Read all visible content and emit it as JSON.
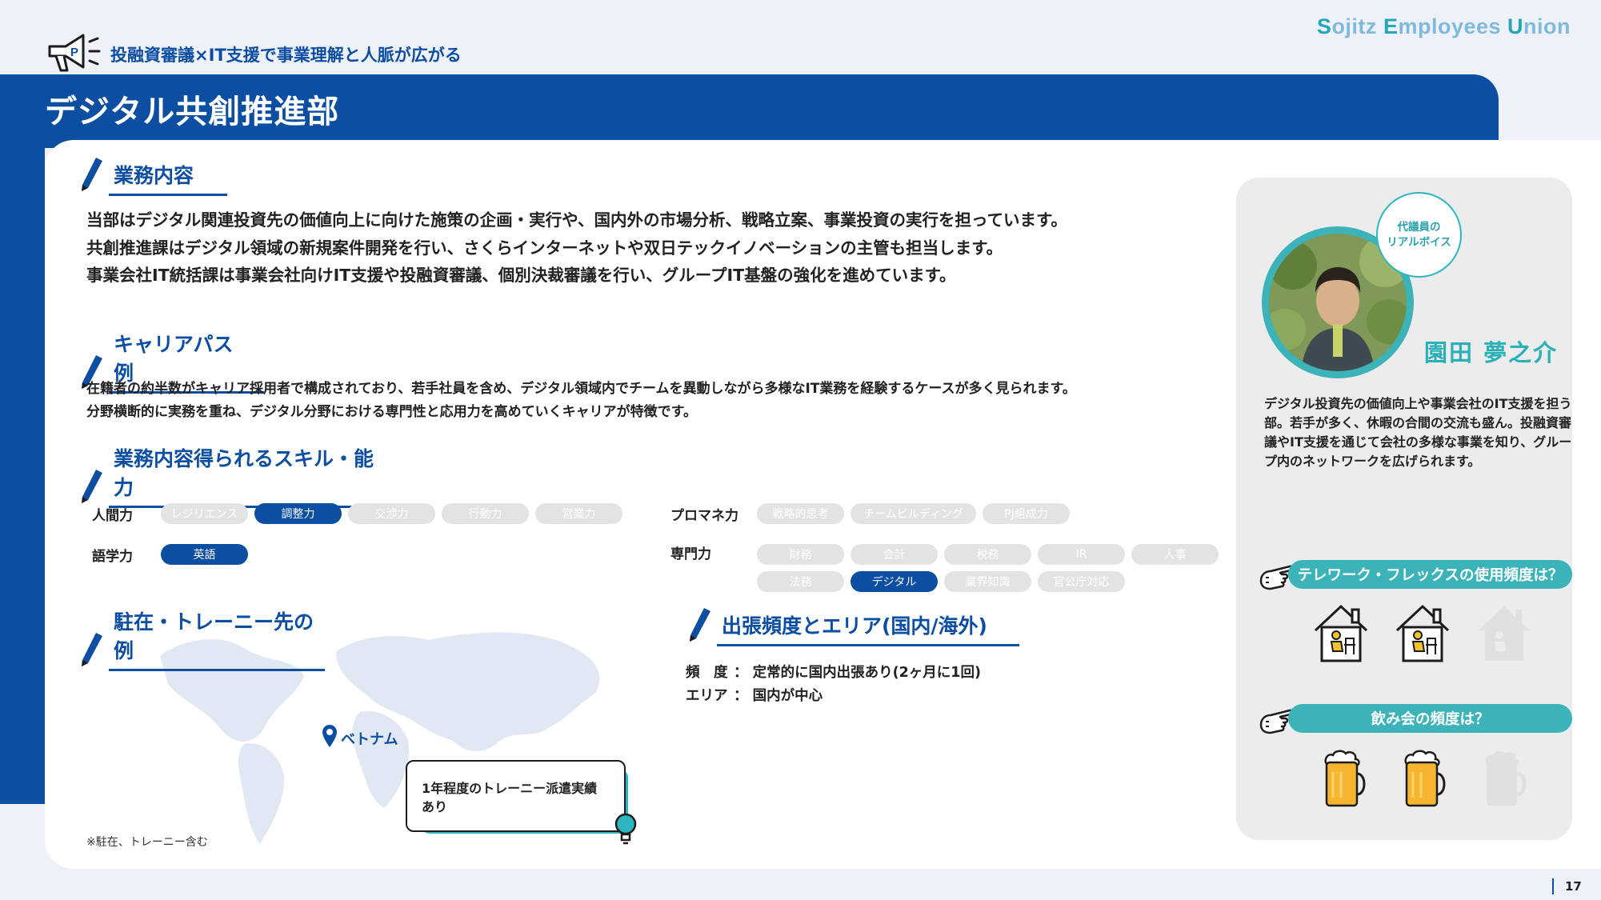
{
  "brand": {
    "parts": [
      {
        "cap": "S",
        "rest": "ojitz "
      },
      {
        "cap": "E",
        "rest": "mployees "
      },
      {
        "cap": "U",
        "rest": "nion"
      }
    ]
  },
  "header": {
    "subtitle": "投融資審議×IT支援で事業理解と人脈が広がる",
    "title": "デジタル共創推進部"
  },
  "sections": {
    "business": {
      "heading": "業務内容",
      "lines": [
        "当部はデジタル関連投資先の価値向上に向けた施策の企画・実行や、国内外の市場分析、戦略立案、事業投資の実行を担っています。",
        "共創推進課はデジタル領域の新規案件開発を行い、さくらインターネットや双日テックイノベーションの主管も担当します。",
        "事業会社IT統括課は事業会社向けIT支援や投融資審議、個別決裁審議を行い、グループIT基盤の強化を進めています。"
      ]
    },
    "career": {
      "heading": "キャリアパス例",
      "lines": [
        "在籍者の約半数がキャリア採用者で構成されており、若手社員を含め、デジタル領域内でチームを異動しながら多様なIT業務を経験するケースが多く見られます。",
        "分野横断的に実務を重ね、デジタル分野における専門性と応用力を高めていくキャリアが特徴です。"
      ]
    },
    "skills": {
      "heading": "業務内容得られるスキル・能力",
      "groups": [
        {
          "label": "人間力",
          "items": [
            {
              "name": "レジリエンス",
              "active": false
            },
            {
              "name": "調整力",
              "active": true
            },
            {
              "name": "交渉力",
              "active": false
            },
            {
              "name": "行動力",
              "active": false
            },
            {
              "name": "営業力",
              "active": false
            }
          ]
        },
        {
          "label": "語学力",
          "items": [
            {
              "name": "英語",
              "active": true
            }
          ]
        },
        {
          "label": "プロマネ力",
          "items": [
            {
              "name": "戦略的思考",
              "active": false
            },
            {
              "name": "チームビルディング",
              "active": false
            },
            {
              "name": "PJ組成力",
              "active": false
            }
          ]
        },
        {
          "label": "専門力",
          "items": [
            {
              "name": "財務",
              "active": false
            },
            {
              "name": "会計",
              "active": false
            },
            {
              "name": "税務",
              "active": false
            },
            {
              "name": "IR",
              "active": false
            },
            {
              "name": "人事",
              "active": false
            },
            {
              "name": "法務",
              "active": false
            },
            {
              "name": "デジタル",
              "active": true
            },
            {
              "name": "業界知識",
              "active": false
            },
            {
              "name": "官公庁対応",
              "active": false
            }
          ]
        }
      ]
    },
    "postings": {
      "heading": "駐在・トレーニー先の例",
      "location": "ベトナム",
      "callout_line1": "1年程度のトレーニー派遣実績",
      "callout_line2": "あり",
      "note": "※駐在、トレーニー含む"
    },
    "travel": {
      "heading": "出張頻度とエリア(国内/海外)",
      "rows": [
        {
          "key": "頻　度",
          "value": "定常的に国内出張あり(2ヶ月に1回)"
        },
        {
          "key": "エリア",
          "value": "国内が中心"
        }
      ]
    }
  },
  "voice": {
    "bubble_line1": "代議員の",
    "bubble_line2": "リアルボイス",
    "name": "園田 夢之介",
    "description": "デジタル投資先の価値向上や事業会社のIT支援を担う部。若手が多く、休暇の合間の交流も盛ん。投融資審議やIT支援を通じて会社の多様な事業を知り、グループ内のネットワークを広げられます。",
    "telework": {
      "question": "テレワーク・フレックスの使用頻度は？",
      "level": 2,
      "max": 3
    },
    "drinking": {
      "question": "飲み会の頻度は？",
      "level": 2,
      "max": 3
    }
  },
  "colors": {
    "primary": "#0b4ea2",
    "accent": "#3bb3b9",
    "pill_off": "#e3e3e3"
  },
  "page": {
    "number": "17"
  }
}
